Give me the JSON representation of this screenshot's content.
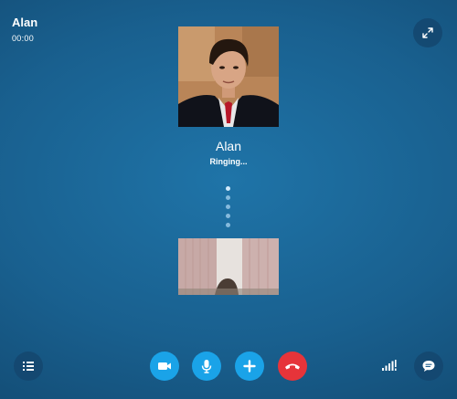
{
  "header": {
    "caller_name": "Alan",
    "call_duration": "00:00"
  },
  "contact": {
    "name": "Alan",
    "status": "Ringing..."
  },
  "icons": {
    "expand": "expand-arrows-icon",
    "participants": "list-icon",
    "video": "video-camera-icon",
    "microphone": "microphone-icon",
    "add": "plus-icon",
    "hang_up": "phone-hang-up-icon",
    "signal": "signal-strength-icon",
    "chat": "chat-bubble-icon"
  },
  "colors": {
    "background": "#1a6a9c",
    "accent_blue": "#1aa3e8",
    "hang_up_red": "#e6343a"
  }
}
